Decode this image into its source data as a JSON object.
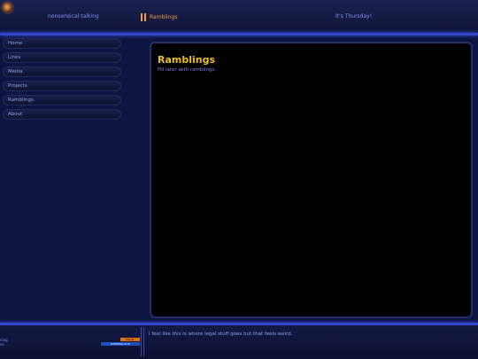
{
  "header": {
    "site_name": "nonsensical talking",
    "current_section": "Ramblings",
    "day_message": "It's Thursday!"
  },
  "sidebar": {
    "items": [
      {
        "label": "Home"
      },
      {
        "label": "Links"
      },
      {
        "label": "Media"
      },
      {
        "label": "Projects"
      },
      {
        "label": "Ramblings"
      },
      {
        "label": "About"
      }
    ]
  },
  "main": {
    "title": "Ramblings",
    "body": "Fill later with ramblings."
  },
  "footer": {
    "left_line1": "ning",
    "left_line2": "ns",
    "badge_top": "88x31",
    "badge_bottom": "WEBRING.SITE",
    "legal_text": "I feel like this is where legal stuff goes but that feels weird."
  },
  "colors": {
    "background": "#0e1440",
    "accent_line": "#3447c8",
    "title": "#e8c020",
    "active_nav": "#f0a040",
    "text": "#8aa0e8"
  }
}
